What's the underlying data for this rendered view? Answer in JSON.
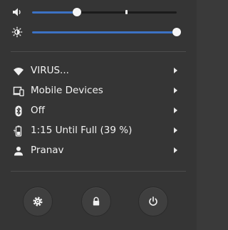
{
  "sliders": [
    {
      "name": "volume",
      "icon": "volume-icon",
      "value": 0.31,
      "mark": 0.65
    },
    {
      "name": "brightness",
      "icon": "brightness-icon",
      "value": 1.0
    }
  ],
  "menu": [
    {
      "icon": "wifi-icon",
      "label": "VIRUS..."
    },
    {
      "icon": "mobile-devices-icon",
      "label": "Mobile Devices"
    },
    {
      "icon": "bluetooth-icon",
      "label": "Off"
    },
    {
      "icon": "battery-icon",
      "label": "1:15 Until Full (39 %)"
    },
    {
      "icon": "user-icon",
      "label": "Pranav"
    }
  ],
  "buttons": [
    {
      "icon": "settings-icon"
    },
    {
      "icon": "lock-icon"
    },
    {
      "icon": "power-icon"
    }
  ],
  "colors": {
    "accent": "#3c72c4",
    "background": "#353535",
    "text": "#f2f2f2"
  }
}
